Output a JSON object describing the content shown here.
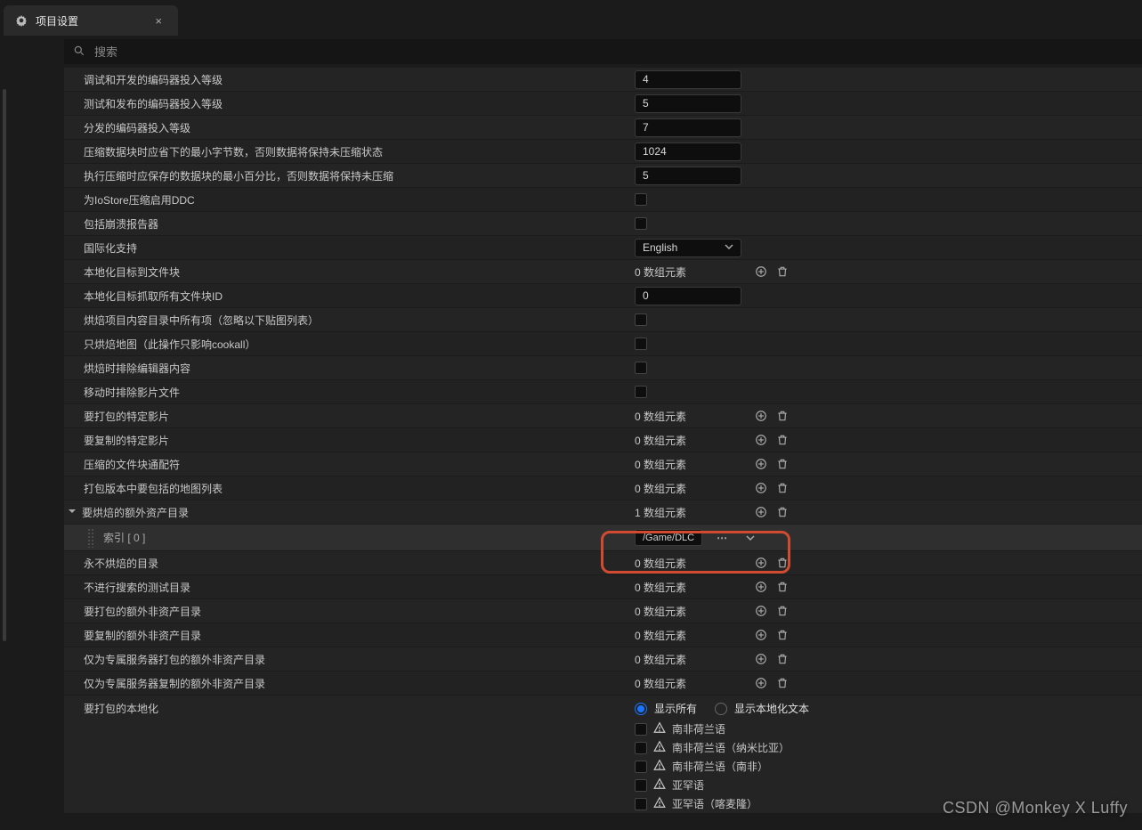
{
  "tab": {
    "title": "项目设置"
  },
  "search": {
    "placeholder": "搜索"
  },
  "rows": {
    "r1": {
      "label": "调试和开发的编码器投入等级",
      "value": "4"
    },
    "r2": {
      "label": "测试和发布的编码器投入等级",
      "value": "5"
    },
    "r3": {
      "label": "分发的编码器投入等级",
      "value": "7"
    },
    "r4": {
      "label": "压缩数据块时应省下的最小字节数，否则数据将保持未压缩状态",
      "value": "1024"
    },
    "r5": {
      "label": "执行压缩时应保存的数据块的最小百分比，否则数据将保持未压缩",
      "value": "5"
    },
    "r6": {
      "label": "为IoStore压缩启用DDC"
    },
    "r7": {
      "label": "包括崩溃报告器"
    },
    "r8": {
      "label": "国际化支持",
      "dropdown": "English"
    },
    "r9": {
      "label": "本地化目标到文件块",
      "count": "0 数组元素"
    },
    "r10": {
      "label": "本地化目标抓取所有文件块ID",
      "value": "0"
    },
    "r11": {
      "label": "烘焙项目内容目录中所有项（忽略以下贴图列表）"
    },
    "r12": {
      "label": "只烘焙地图（此操作只影响cookall）"
    },
    "r13": {
      "label": "烘焙时排除编辑器内容"
    },
    "r14": {
      "label": "移动时排除影片文件"
    },
    "r15": {
      "label": "要打包的特定影片",
      "count": "0 数组元素"
    },
    "r16": {
      "label": "要复制的特定影片",
      "count": "0 数组元素"
    },
    "r17": {
      "label": "压缩的文件块通配符",
      "count": "0 数组元素"
    },
    "r18": {
      "label": "打包版本中要包括的地图列表",
      "count": "0 数组元素"
    },
    "r19": {
      "label": "要烘焙的额外资产目录",
      "count": "1 数组元素",
      "child_label": "索引 [ 0 ]",
      "child_value": "/Game/DLC"
    },
    "r20": {
      "label": "永不烘焙的目录",
      "count": "0 数组元素"
    },
    "r21": {
      "label": "不进行搜索的测试目录",
      "count": "0 数组元素"
    },
    "r22": {
      "label": "要打包的额外非资产目录",
      "count": "0 数组元素"
    },
    "r23": {
      "label": "要复制的额外非资产目录",
      "count": "0 数组元素"
    },
    "r24": {
      "label": "仅为专属服务器打包的额外非资产目录",
      "count": "0 数组元素"
    },
    "r25": {
      "label": "仅为专属服务器复制的额外非资产目录",
      "count": "0 数组元素"
    },
    "r26": {
      "label": "要打包的本地化",
      "radio_all": "显示所有",
      "radio_loc": "显示本地化文本",
      "locales": [
        "南非荷兰语",
        "南非荷兰语（纳米比亚）",
        "南非荷兰语（南非）",
        "亚罕语",
        "亚罕语（喀麦隆）"
      ]
    }
  },
  "watermark": "CSDN @Monkey X Luffy"
}
